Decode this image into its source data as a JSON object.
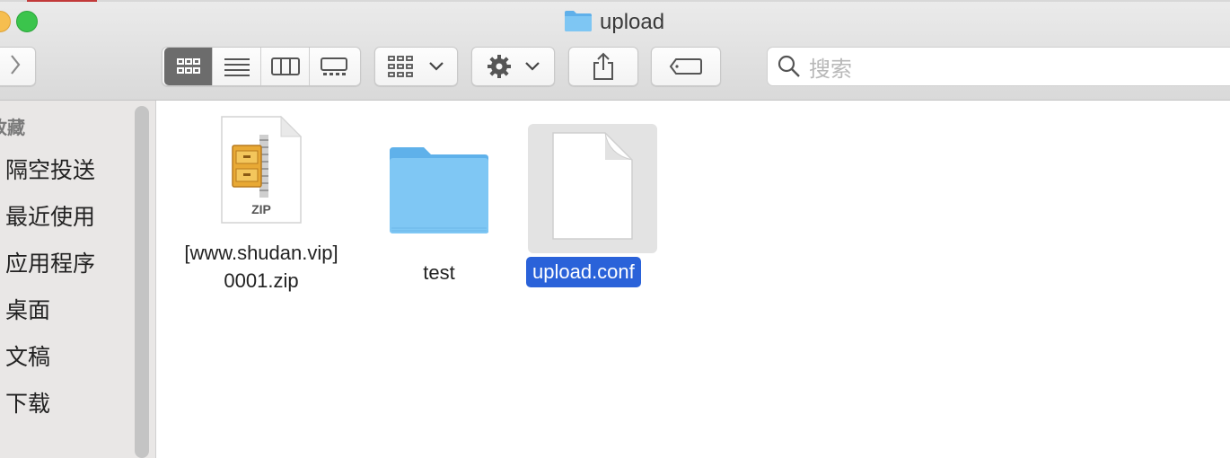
{
  "window": {
    "title": "upload"
  },
  "toolbar": {
    "search_placeholder": "搜索",
    "view_modes": [
      "icon-view",
      "list-view",
      "column-view",
      "gallery-view"
    ],
    "active_view": "icon-view"
  },
  "sidebar": {
    "heading": "收藏",
    "items": [
      {
        "label": "隔空投送"
      },
      {
        "label": "最近使用"
      },
      {
        "label": "应用程序"
      },
      {
        "label": "桌面"
      },
      {
        "label": "文稿"
      },
      {
        "label": "下载"
      }
    ]
  },
  "files": [
    {
      "name_line1": "[www.shudan.vip]",
      "name_line2": "0001.zip",
      "icon": "zip-icon",
      "badge": "ZIP"
    },
    {
      "name": "test",
      "icon": "folder-icon"
    },
    {
      "name": "upload.conf",
      "icon": "document-icon",
      "selected": true
    }
  ],
  "colors": {
    "selection": "#2a62d9",
    "folder": "#74c0f0"
  }
}
